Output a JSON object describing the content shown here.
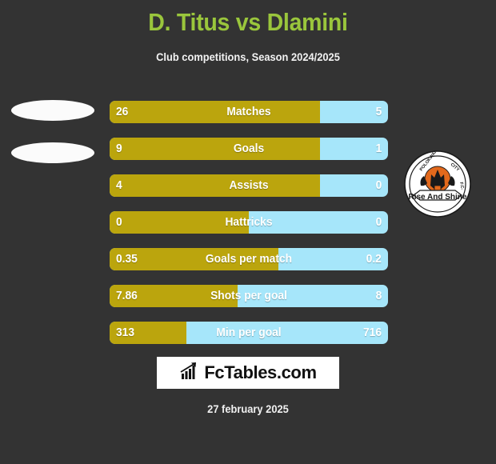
{
  "header": {
    "title": "D. Titus vs Dlamini",
    "subtitle": "Club competitions, Season 2024/2025",
    "title_color": "#9ac63c"
  },
  "colors": {
    "background": "#333333",
    "left_bar": "#bba50d",
    "right_bar": "#a6e6fa",
    "text": "#ffffff"
  },
  "players": {
    "left": {
      "name": "D. Titus",
      "avatar": "player-photo-placeholder"
    },
    "right": {
      "name": "Dlamini",
      "avatar": "player-photo-placeholder"
    }
  },
  "crest": {
    "name": "polokwane-city-fc-crest",
    "club_top": "POLOKWANE",
    "club_right": "CITY",
    "club_bottom": "F.C.",
    "motto": "Rise And Shine"
  },
  "chart_data": {
    "type": "bar",
    "title": "D. Titus vs Dlamini",
    "subtitle": "Club competitions, Season 2024/2025",
    "orientation": "horizontal-diverging",
    "legend": [
      "D. Titus",
      "Dlamini"
    ],
    "categories": [
      "Matches",
      "Goals",
      "Assists",
      "Hattricks",
      "Goals per match",
      "Shots per goal",
      "Min per goal"
    ],
    "series": [
      {
        "name": "D. Titus",
        "values": [
          26,
          9,
          4,
          0,
          0.35,
          7.86,
          313
        ]
      },
      {
        "name": "Dlamini",
        "values": [
          5,
          1,
          0,
          0,
          0.2,
          8,
          716
        ]
      }
    ],
    "rows": [
      {
        "label": "Matches",
        "left_value": "26",
        "right_value": "5",
        "left_pct": 75.5
      },
      {
        "label": "Goals",
        "left_value": "9",
        "right_value": "1",
        "left_pct": 75.5
      },
      {
        "label": "Assists",
        "left_value": "4",
        "right_value": "0",
        "left_pct": 75.5
      },
      {
        "label": "Hattricks",
        "left_value": "0",
        "right_value": "0",
        "left_pct": 50.0
      },
      {
        "label": "Goals per match",
        "left_value": "0.35",
        "right_value": "0.2",
        "left_pct": 60.6
      },
      {
        "label": "Shots per goal",
        "left_value": "7.86",
        "right_value": "8",
        "left_pct": 46.0
      },
      {
        "label": "Min per goal",
        "left_value": "313",
        "right_value": "716",
        "left_pct": 27.6
      }
    ]
  },
  "footer": {
    "brand": "FcTables.com",
    "brand_icon": "bar-chart-icon",
    "date": "27 february 2025"
  }
}
